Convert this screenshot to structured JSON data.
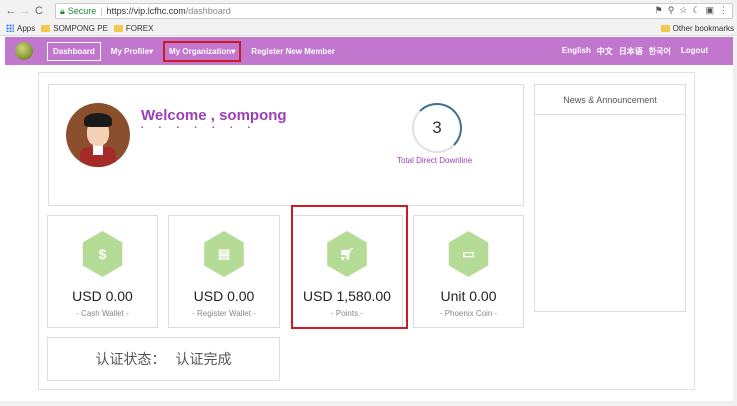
{
  "browser": {
    "secure_label": "Secure",
    "url_host": "https://vip.lcfhc.com",
    "url_path": "/dashboard",
    "bookmarks": [
      "Apps",
      "SOMPONG PE",
      "FOREX"
    ],
    "other_bookmarks": "Other bookmarks"
  },
  "nav": {
    "dashboard": "Dashboard",
    "my_profile": "My Profile",
    "my_organization": "My Organization",
    "register": "Register New Member",
    "lang_en": "English",
    "lang_zh": "中文",
    "lang_ja": "日本语",
    "lang_ko": "한국어",
    "logout": "Logout"
  },
  "welcome": {
    "text": "Welcome , sompong",
    "downline_count": "3",
    "downline_label": "Total Direct Downline"
  },
  "news": {
    "title": "News & Announcement"
  },
  "stats": [
    {
      "value": "USD 0.00",
      "label": "- Cash Wallet -",
      "icon": "dollar-icon"
    },
    {
      "value": "USD 0.00",
      "label": "- Register Wallet -",
      "icon": "document-icon"
    },
    {
      "value": "USD 1,580.00",
      "label": "- Points -",
      "icon": "cart-icon"
    },
    {
      "value": "Unit 0.00",
      "label": "- Phoenix Coin -",
      "icon": "laptop-icon"
    }
  ],
  "verify": {
    "label": "认证状态：",
    "status": "认证完成"
  },
  "colors": {
    "nav_bg": "#c277cf",
    "accent_purple": "#9b3fb6",
    "hex_green": "#b5dc96",
    "highlight_red": "#cc1b25"
  }
}
